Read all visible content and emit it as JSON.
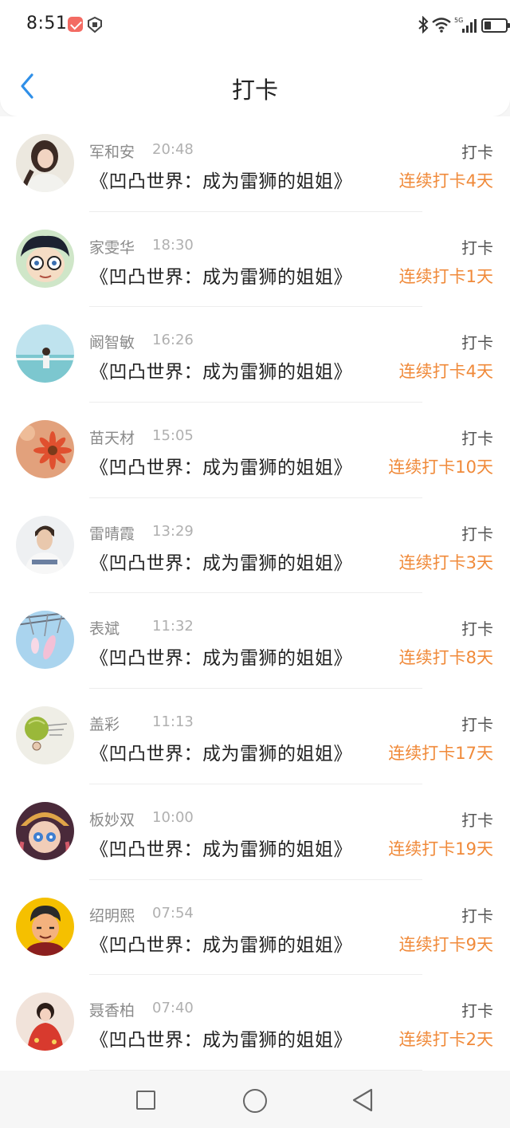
{
  "status_bar": {
    "time": "8:51",
    "network": "5G"
  },
  "header": {
    "title": "打卡"
  },
  "records": [
    {
      "name": "军和安",
      "time": "20:48",
      "book": "《凹凸世界：成为雷狮的姐姐》",
      "action": "打卡",
      "streak": "连续打卡4天"
    },
    {
      "name": "家雯华",
      "time": "18:30",
      "book": "《凹凸世界：成为雷狮的姐姐》",
      "action": "打卡",
      "streak": "连续打卡1天"
    },
    {
      "name": "阚智敏",
      "time": "16:26",
      "book": "《凹凸世界：成为雷狮的姐姐》",
      "action": "打卡",
      "streak": "连续打卡4天"
    },
    {
      "name": "苗天材",
      "time": "15:05",
      "book": "《凹凸世界：成为雷狮的姐姐》",
      "action": "打卡",
      "streak": "连续打卡10天"
    },
    {
      "name": "雷晴霞",
      "time": "13:29",
      "book": "《凹凸世界：成为雷狮的姐姐》",
      "action": "打卡",
      "streak": "连续打卡3天"
    },
    {
      "name": "表斌",
      "time": "11:32",
      "book": "《凹凸世界：成为雷狮的姐姐》",
      "action": "打卡",
      "streak": "连续打卡8天"
    },
    {
      "name": "盖彩",
      "time": "11:13",
      "book": "《凹凸世界：成为雷狮的姐姐》",
      "action": "打卡",
      "streak": "连续打卡17天"
    },
    {
      "name": "板妙双",
      "time": "10:00",
      "book": "《凹凸世界：成为雷狮的姐姐》",
      "action": "打卡",
      "streak": "连续打卡19天"
    },
    {
      "name": "绍明熙",
      "time": "07:54",
      "book": "《凹凸世界：成为雷狮的姐姐》",
      "action": "打卡",
      "streak": "连续打卡9天"
    },
    {
      "name": "聂香柏",
      "time": "07:40",
      "book": "《凹凸世界：成为雷狮的姐姐》",
      "action": "打卡",
      "streak": "连续打卡2天"
    }
  ],
  "colors": {
    "accent_orange": "#f08a3a",
    "back_blue": "#2f8fe8"
  }
}
